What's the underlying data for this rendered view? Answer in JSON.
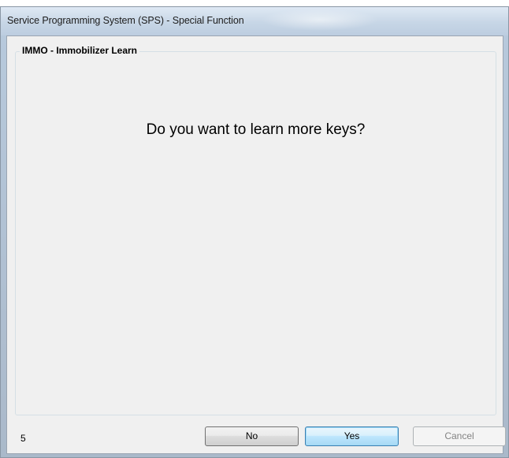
{
  "window": {
    "title": "Service Programming System (SPS) - Special Function"
  },
  "group": {
    "legend": "IMMO - Immobilizer Learn"
  },
  "main": {
    "question": "Do you want to learn more keys?"
  },
  "footer": {
    "step_number": "5",
    "no_label": "No",
    "yes_label": "Yes",
    "cancel_label": "Cancel"
  },
  "colors": {
    "titlebar": "#c7d6e6",
    "client_background": "#f0f0f0",
    "default_button_border": "#3c7fb1"
  }
}
